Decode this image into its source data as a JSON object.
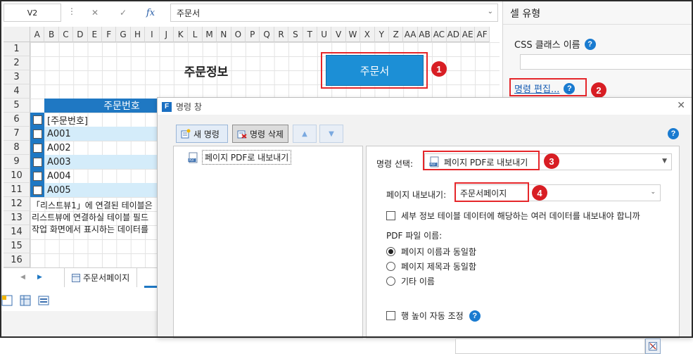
{
  "formula_bar": {
    "name_box": "V2",
    "cancel_icon": "✕",
    "enter_icon": "✓",
    "fx_label": "fx",
    "formula_value": "주문서"
  },
  "sheet": {
    "columns": [
      "A",
      "B",
      "C",
      "D",
      "E",
      "F",
      "G",
      "H",
      "I",
      "J",
      "K",
      "L",
      "M",
      "N",
      "O",
      "P",
      "Q",
      "R",
      "S",
      "T",
      "U",
      "V",
      "W",
      "X",
      "Y",
      "Z",
      "AA",
      "AB",
      "AC",
      "AD",
      "AE",
      "AF"
    ],
    "rows": [
      "1",
      "2",
      "3",
      "4",
      "5",
      "6",
      "7",
      "8",
      "9",
      "10",
      "11",
      "12",
      "13",
      "14",
      "15",
      "16"
    ],
    "title": "주문정보",
    "order_button": "주문서",
    "list_header": "주문번호",
    "list_items": [
      "[주문번호]",
      "A001",
      "A002",
      "A003",
      "A004",
      "A005"
    ],
    "notes": [
      "「리스트뷰1」에 연결된 테이블은",
      "리스트뷰에 연결하실 테이블 필드",
      "작업 화면에서 표시하는 데이터를"
    ],
    "tabs": [
      "주문서페이지"
    ]
  },
  "right_panel": {
    "title": "셀 유형",
    "css_label": "CSS 클래스 이름",
    "command_edit": "명령 편집..."
  },
  "dialog": {
    "title": "명령 창",
    "new_command": "새 명령",
    "delete_command": "명령 삭제",
    "command_list": [
      "페이지 PDF로 내보내기"
    ],
    "select_label": "명령 선택:",
    "select_value": "페이지 PDF로 내보내기",
    "page_export_label": "페이지 내보내기:",
    "page_export_value": "주문서페이지",
    "detail_checkbox": "세부 정보 테이블 데이터에 해당하는 여러 데이터를 내보내야 합니까",
    "pdf_filename_label": "PDF 파일 이름:",
    "radio_options": [
      "페이지 이름과 동일함",
      "페이지 제목과 동일함",
      "기타 이름"
    ],
    "radio_selected": 0,
    "row_height_label": "행 높이 자동 조정"
  },
  "badges": [
    "1",
    "2",
    "3",
    "4"
  ],
  "colors": {
    "accent": "#1f78c3",
    "button_blue": "#1c8fd6",
    "highlight_red": "#e5262a",
    "badge_red": "#d81e24",
    "alt_row": "#d4ecfa"
  }
}
